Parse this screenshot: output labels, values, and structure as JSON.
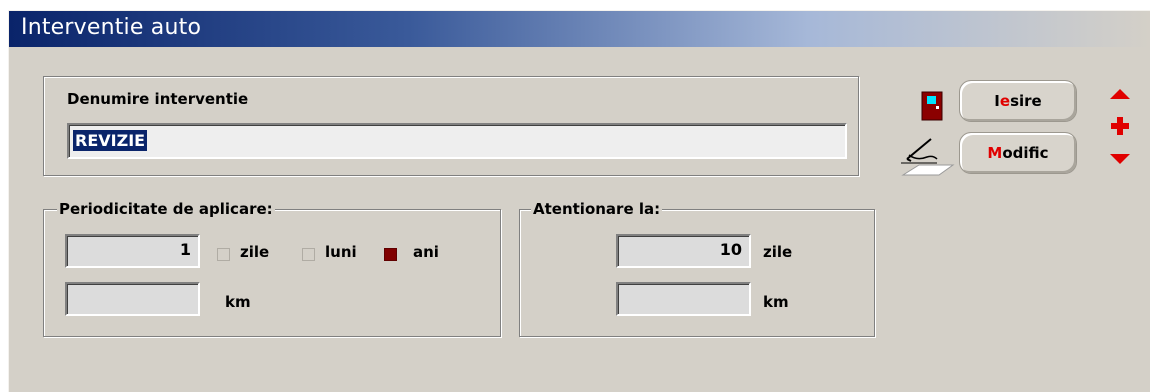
{
  "window": {
    "title": "Interventie auto"
  },
  "denumire": {
    "label": "Denumire interventie",
    "value": "REVIZIE"
  },
  "buttons": {
    "iesire": {
      "pre": "I",
      "hot": "e",
      "post": "sire"
    },
    "modific": {
      "pre": "",
      "hot": "M",
      "post": "odific"
    }
  },
  "periodicitate": {
    "title": "Periodicitate de aplicare:",
    "value": "1",
    "options": {
      "zile": "zile",
      "luni": "luni",
      "ani": "ani"
    },
    "selected": "ani",
    "km_value": "",
    "km_label": "km"
  },
  "atentionare": {
    "title": "Atentionare la:",
    "zile_value": "10",
    "zile_label": "zile",
    "km_value": "",
    "km_label": "km"
  },
  "colors": {
    "accent_red": "#e00000",
    "checked": "#800000",
    "title_start": "#0a246a"
  },
  "icons": [
    "door-exit-icon",
    "edit-pen-icon",
    "arrow-up-icon",
    "add-plus-icon",
    "arrow-down-icon"
  ]
}
